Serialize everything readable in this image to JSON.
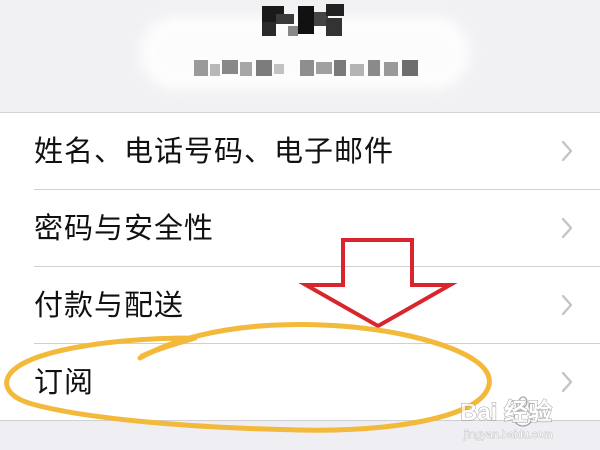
{
  "settings": {
    "items": [
      {
        "label": "姓名、电话号码、电子邮件"
      },
      {
        "label": "密码与安全性"
      },
      {
        "label": "付款与配送"
      },
      {
        "label": "订阅"
      }
    ]
  },
  "watermark": {
    "brand": "Bai 经验",
    "url": "jingyan.baidu.com"
  },
  "colors": {
    "annotation_arrow": "#d8262c",
    "annotation_circle": "#f2b93b",
    "chevron": "#c4c4c8",
    "list_background": "#ffffff",
    "page_background": "#f2f2f6"
  },
  "icons": {
    "chevron": "chevron-right-icon",
    "arrow": "down-arrow-icon"
  }
}
